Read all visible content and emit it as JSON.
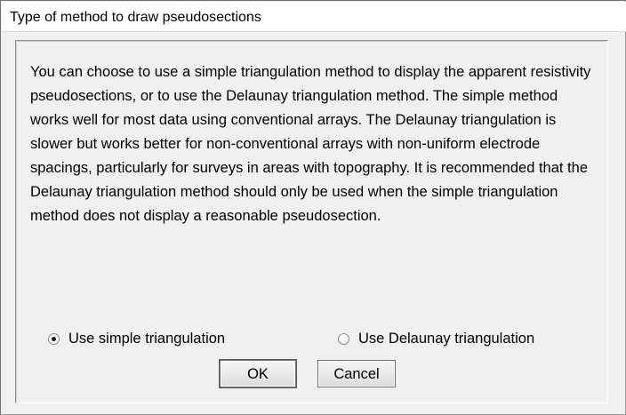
{
  "window": {
    "title": "Type of method to draw pseudosections"
  },
  "message": "You can choose to use a simple triangulation method to display the apparent resistivity pseudosections, or to use the Delaunay triangulation method. The simple method works well for most data using conventional arrays. The Delaunay triangulation is slower but works better for non-conventional arrays with non-uniform electrode spacings, particularly for surveys in areas with topography. It is recommended that the Delaunay triangulation method should only be used when the simple triangulation method does not display a reasonable pseudosection.",
  "options": [
    {
      "label": "Use simple triangulation",
      "selected": true
    },
    {
      "label": "Use Delaunay triangulation",
      "selected": false
    }
  ],
  "buttons": {
    "ok_label": "OK",
    "cancel_label": "Cancel"
  }
}
